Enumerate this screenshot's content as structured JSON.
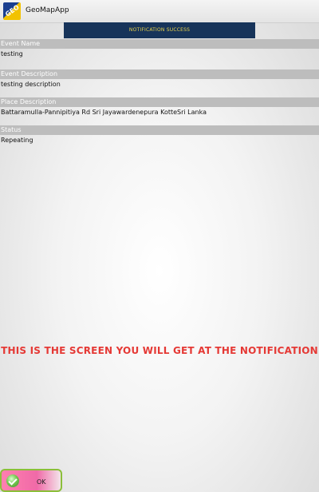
{
  "app": {
    "icon": "geomap-app-icon",
    "title": "GeoMapApp"
  },
  "banner": {
    "text": "NOTIFICATION SUCCESS"
  },
  "sections": {
    "event_name": {
      "label": "Event Name",
      "value": "testing"
    },
    "event_description": {
      "label": "Event Description",
      "value": "testing description"
    },
    "place_description": {
      "label": "Place Description",
      "value": "Battaramulla-Pannipitiya Rd Sri Jayawardenepura KotteSri Lanka"
    },
    "status": {
      "label": "Status",
      "value": "Repeating"
    }
  },
  "notice": {
    "text": "THIS IS THE SCREEN YOU WILL GET AT THE NOTIFICATION",
    "color": "#e53935"
  },
  "ok_button": {
    "label": "OK",
    "icon": "check-icon"
  },
  "colors": {
    "banner_bg": "#17345a",
    "banner_text": "#e9d24a",
    "section_head_bg": "#bdbdbd"
  }
}
